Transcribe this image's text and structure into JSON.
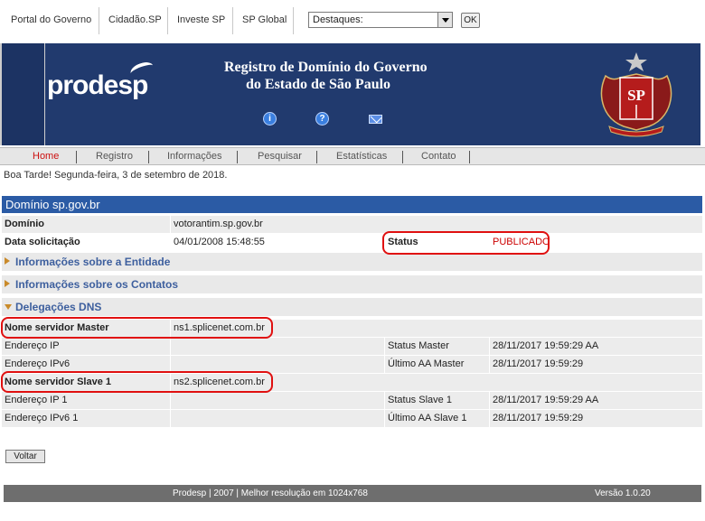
{
  "gov_bar": {
    "links": [
      "Portal do Governo",
      "Cidadão.SP",
      "Investe SP",
      "SP Global"
    ],
    "destaques_value": "Destaques:",
    "ok_label": "OK"
  },
  "banner": {
    "logo": "prodesp",
    "title_line1": "Registro de Domínio do Governo",
    "title_line2": "do Estado de São Paulo",
    "icons": [
      "info-icon",
      "help-icon",
      "mail-icon"
    ],
    "seal_letters": "SP"
  },
  "nav": {
    "items": [
      "Home",
      "Registro",
      "Informações",
      "Pesquisar",
      "Estatísticas",
      "Contato"
    ],
    "active": "Home"
  },
  "greeting": "Boa Tarde! Segunda-feira, 3 de setembro de 2018.",
  "domain_section": {
    "header": "Domínio sp.gov.br",
    "dominio_label": "Domínio",
    "dominio_value": "votorantim.sp.gov.br",
    "data_label": "Data solicitação",
    "data_value": "04/01/2008 15:48:55",
    "status_label": "Status",
    "status_value": "PUBLICADO"
  },
  "accordions": {
    "entidade": "Informações sobre a Entidade",
    "contatos": "Informações sobre os Contatos",
    "dns": "Delegações DNS"
  },
  "dns": {
    "master_label": "Nome servidor Master",
    "master_value": "ns1.splicenet.com.br",
    "ip_label": "Endereço IP",
    "ip_value": "",
    "status_master_label": "Status Master",
    "status_master_value": "28/11/2017 19:59:29 AA",
    "ipv6_label": "Endereço IPv6",
    "ipv6_value": "",
    "ultimo_master_label": "Último AA Master",
    "ultimo_master_value": "28/11/2017 19:59:29",
    "slave_label": "Nome servidor Slave 1",
    "slave_value": "ns2.splicenet.com.br",
    "ip1_label": "Endereço IP 1",
    "ip1_value": "",
    "status_slave_label": "Status Slave 1",
    "status_slave_value": "28/11/2017 19:59:29 AA",
    "ipv61_label": "Endereço IPv6 1",
    "ipv61_value": "",
    "ultimo_slave_label": "Último AA Slave 1",
    "ultimo_slave_value": "28/11/2017 19:59:29"
  },
  "voltar_label": "Voltar",
  "footer": {
    "center": "Prodesp | 2007 | Melhor resolução em 1024x768",
    "version": "Versão 1.0.20"
  },
  "colors": {
    "banner": "#213a6e",
    "section_header": "#2b5ba5",
    "highlight": "#e01010",
    "status": "#cc0000"
  }
}
